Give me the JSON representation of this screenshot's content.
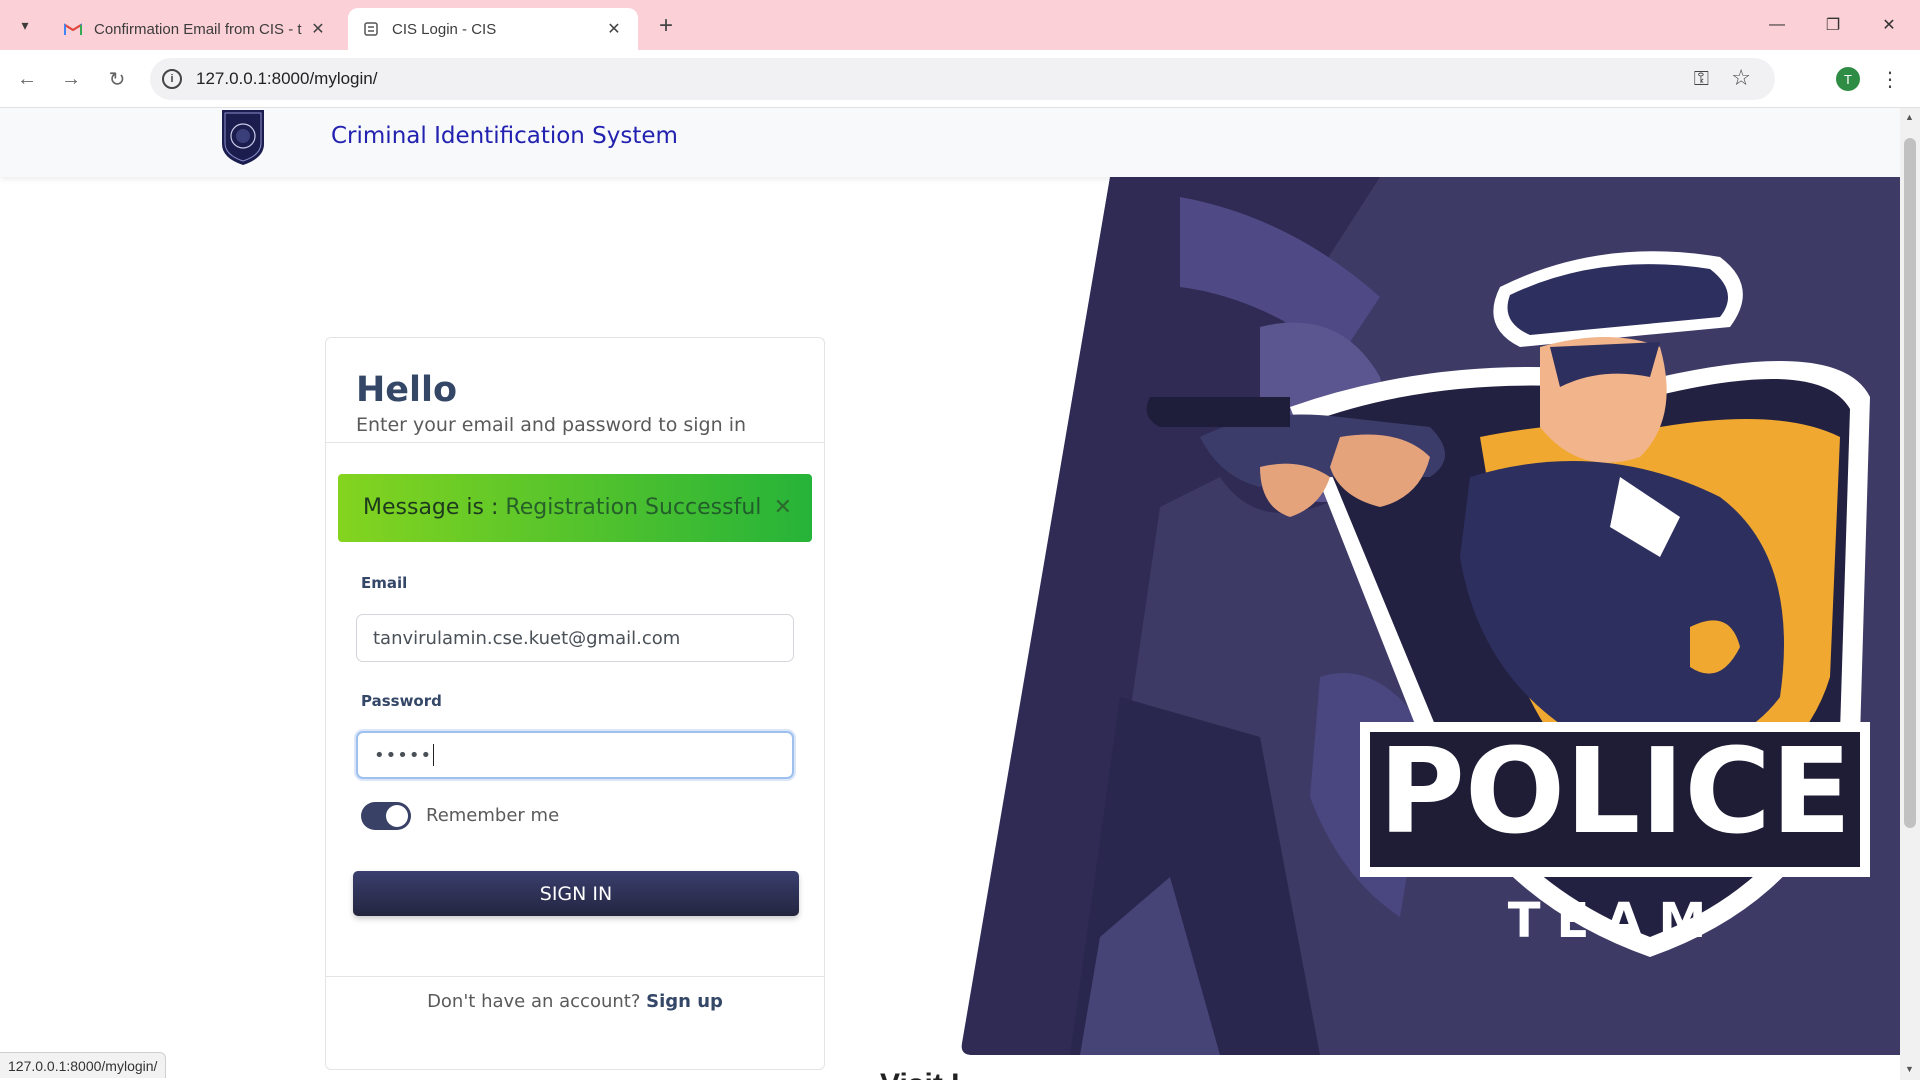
{
  "browser": {
    "tabs": [
      {
        "title": "Confirmation Email from CIS - t",
        "icon": "gmail-icon",
        "active": false
      },
      {
        "title": "CIS Login - CIS",
        "icon": "page-icon",
        "active": true
      }
    ],
    "url": "127.0.0.1:8000/mylogin/",
    "profile_initial": "T",
    "status_url": "127.0.0.1:8000/mylogin/"
  },
  "navbar": {
    "brand": "Criminal Identification System"
  },
  "login": {
    "title": "Hello",
    "subtitle": "Enter your email and password to sign in",
    "alert": {
      "prefix": "Message is : ",
      "message": "Registration Successful",
      "color_start": "#84d41f",
      "color_end": "#26b339"
    },
    "email_label": "Email",
    "email_value": "tanvirulamin.cse.kuet@gmail.com",
    "password_label": "Password",
    "password_value": "•••••",
    "remember_label": "Remember me",
    "remember_checked": true,
    "signin_label": "SIGN IN",
    "signup_prompt": "Don't have an account?",
    "signup_link": "Sign up"
  },
  "hero": {
    "badge_text": "POLICE",
    "badge_subtext": "TEAM"
  },
  "below_fold_text": "Visit L..."
}
